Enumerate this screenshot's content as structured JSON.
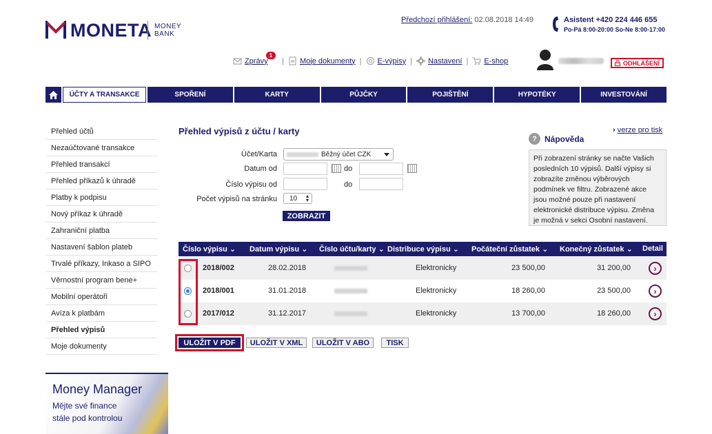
{
  "brand": {
    "name": "MONETA",
    "sub1": "MONEY",
    "sub2": "BANK"
  },
  "header": {
    "prev_login_label": "Předchozí přihlášení:",
    "prev_login_value": "02.08.2018 14:49",
    "assistant": "Asistent +420 224 446 655",
    "hours": "Po-Pá 8:00-20:00 So-Ne 8:00-17:00"
  },
  "topnav": {
    "messages": "Zprávy",
    "messages_count": "1",
    "documents": "Moje dokumenty",
    "estatements": "E-výpisy",
    "settings": "Nastavení",
    "eshop": "E-shop",
    "logout": "ODHLÁŠENÍ"
  },
  "mainnav": [
    "ÚČTY A TRANSAKCE",
    "SPOŘENÍ",
    "KARTY",
    "PŮJČKY",
    "POJIŠTĚNÍ",
    "HYPOTÉKY",
    "INVESTOVÁNÍ"
  ],
  "sidebar": [
    "Přehled účtů",
    "Nezaúčtované transakce",
    "Přehled transakcí",
    "Přehled příkazů k úhradě",
    "Platby k podpisu",
    "Nový příkaz k úhradě",
    "Zahraniční platba",
    "Nastavení šablon plateb",
    "Trvalé příkazy, Inkaso a SIPO",
    "Věrnostní program bene+",
    "Mobilní operátoři",
    "Avíza k platbám",
    "Přehled výpisů",
    "Moje dokumenty"
  ],
  "promo": {
    "title": "Money Manager",
    "text": "Mějte své finance stále pod kontrolou"
  },
  "page": {
    "title": "Přehled výpisů z účtu / karty",
    "print_link": "verze pro tisk",
    "print_arrow": "›"
  },
  "filter": {
    "account_label": "Účet/Karta",
    "account_value": "Běžný účet CZK",
    "date_from_label": "Datum od",
    "to_label": "do",
    "number_from_label": "Číslo výpisu od",
    "per_page_label": "Počet výpisů na stránku",
    "per_page_value": "10",
    "submit": "ZOBRAZIT"
  },
  "help": {
    "icon": "?",
    "title": "Nápověda",
    "text": "Při zobrazení stránky se načte Vašich posledních 10 výpisů. Další výpisy si zobrazíte změnou výběrových podmínek ve filtru. Zobrazené akce jsou možné pouze při nastavení elektronické distribuce výpisu. Změna je možná v sekci Osobní nastavení."
  },
  "table": {
    "headers": {
      "number": "Číslo výpisu ⌄",
      "date": "Datum výpisu ⌄",
      "account": "Číslo účtu/karty ⌄",
      "distribution": "Distribuce výpisu ⌄",
      "opening": "Počáteční zůstatek ⌄",
      "closing": "Konečný zůstatek ⌄",
      "detail": "Detail"
    },
    "rows": [
      {
        "number": "2018/002",
        "date": "28.02.2018",
        "distribution": "Elektronicky",
        "opening": "23 500,00",
        "closing": "31 200,00",
        "selected": false
      },
      {
        "number": "2018/001",
        "date": "31.01.2018",
        "distribution": "Elektronicky",
        "opening": "18 260,00",
        "closing": "23 500,00",
        "selected": true
      },
      {
        "number": "2017/012",
        "date": "31.12.2017",
        "distribution": "Elektronicky",
        "opening": "13 700,00",
        "closing": "18 260,00",
        "selected": false
      }
    ],
    "detail_icon": "›"
  },
  "actions": {
    "pdf": "ULOŽIT V PDF",
    "xml": "ULOŽIT V XML",
    "abo": "ULOŽIT V ABO",
    "print": "TISK"
  },
  "colors": {
    "brand": "#1c1e6b",
    "accent_red": "#d0112b",
    "detail": "#6a1444"
  }
}
